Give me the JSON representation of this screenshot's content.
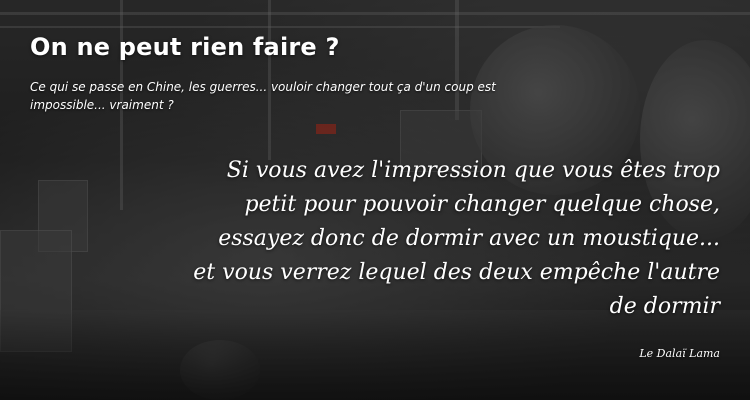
{
  "title": "On ne peut rien faire ?",
  "subtitle": "Ce qui se passe en Chine, les guerres... vouloir changer tout ça d'un coup est impossible... vraiment ?",
  "quote": {
    "lines": [
      "Si vous avez l'impression que vous êtes trop",
      "petit pour pouvoir changer quelque chose,",
      "essayez donc de dormir avec un moustique...",
      "et vous verrez lequel des deux empêche l'autre",
      "de dormir"
    ]
  },
  "author": "Le Dalaï Lama"
}
